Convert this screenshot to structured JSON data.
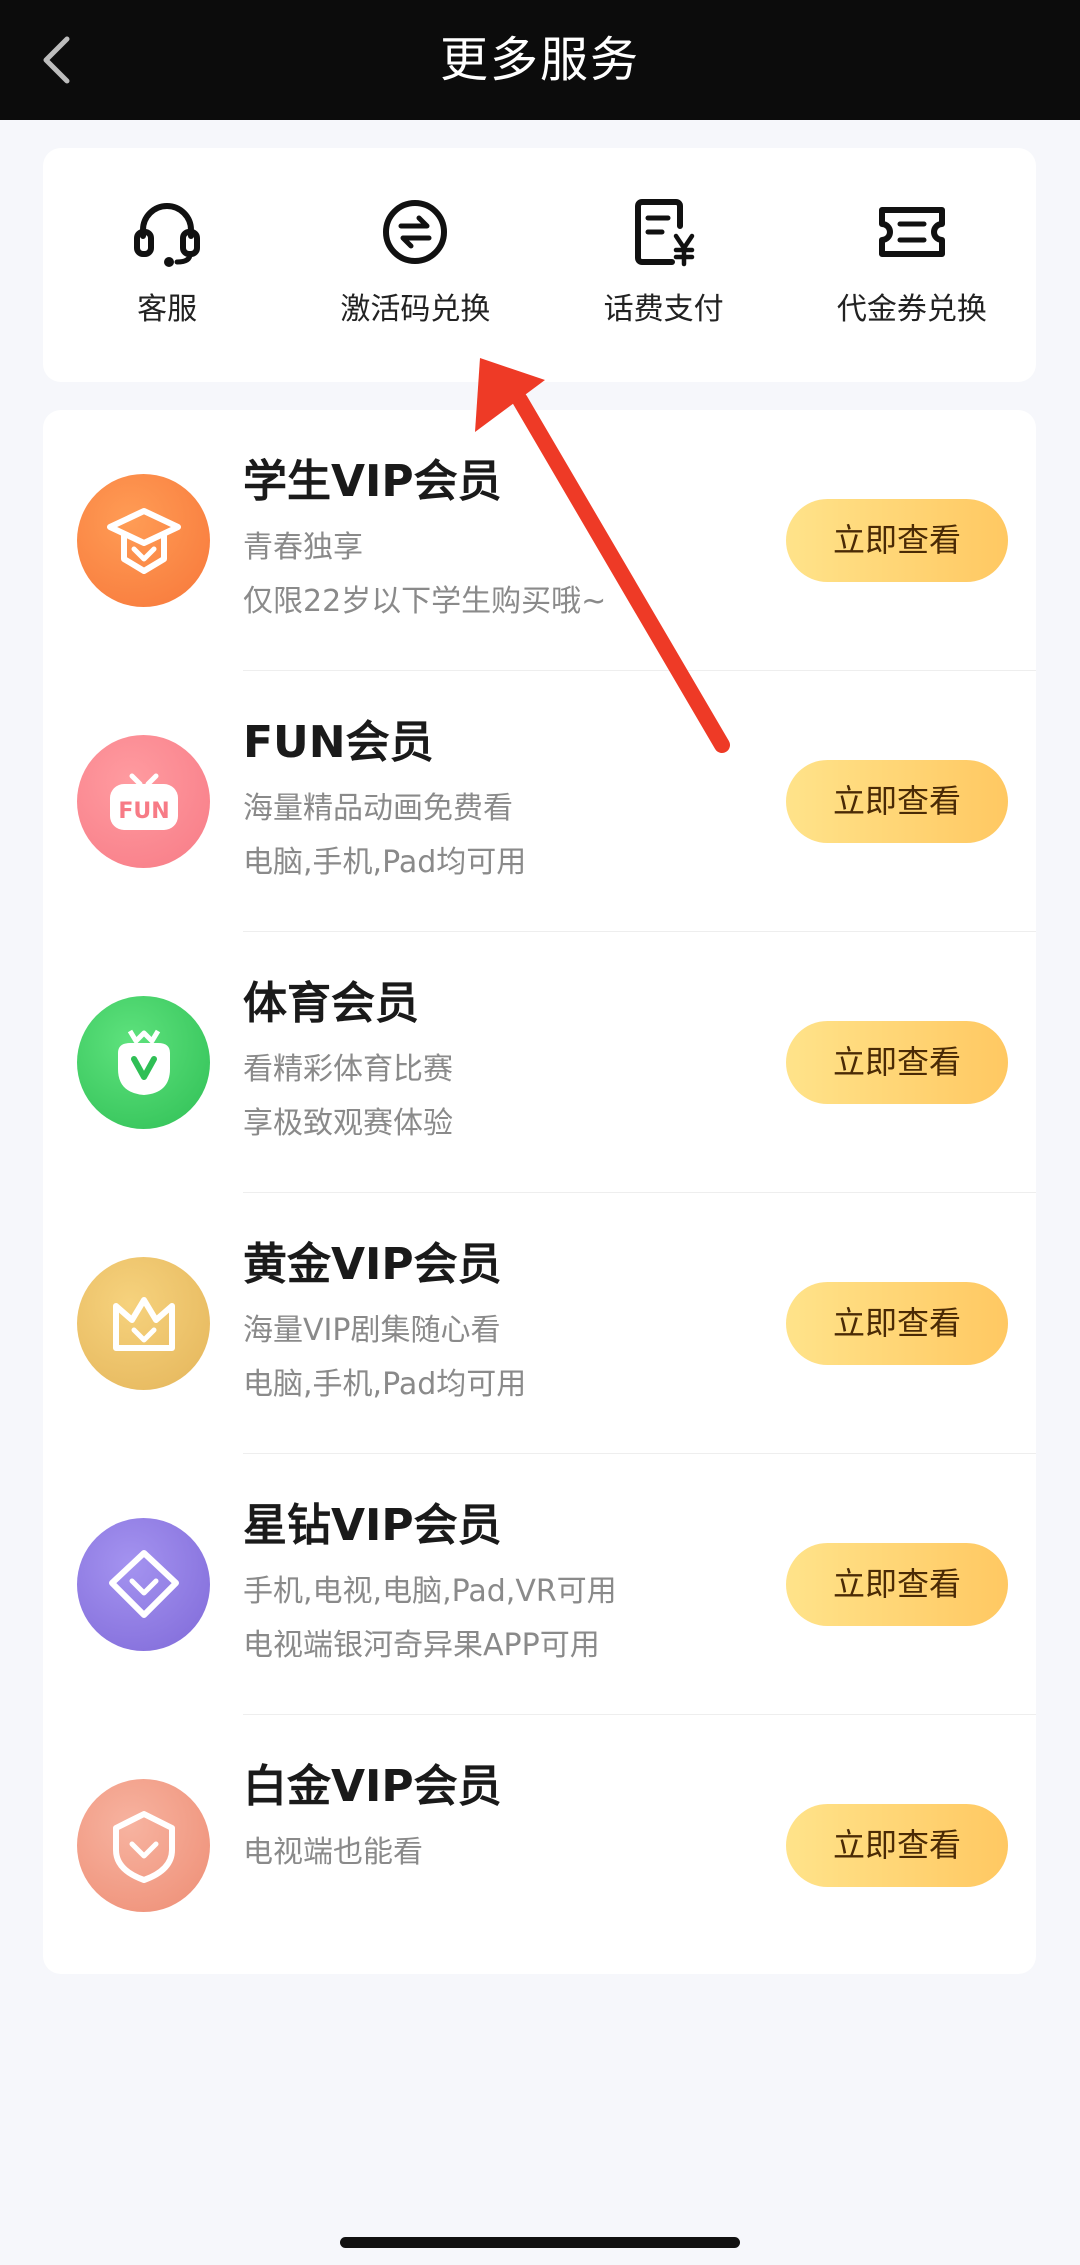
{
  "header": {
    "title": "更多服务",
    "back_icon": "chevron-left-icon"
  },
  "services": [
    {
      "label": "客服",
      "icon": "headset-icon"
    },
    {
      "label": "激活码兑换",
      "icon": "exchange-icon"
    },
    {
      "label": "话费支付",
      "icon": "bill-yuan-icon"
    },
    {
      "label": "代金券兑换",
      "icon": "ticket-icon"
    }
  ],
  "members": [
    {
      "name": "学生VIP会员",
      "desc1": "青春独享",
      "desc2": "仅限22岁以下学生购买哦~",
      "cta": "立即查看",
      "icon": "graduation-cap-icon",
      "color": "#f7873a"
    },
    {
      "name": "FUN会员",
      "desc1": "海量精品动画免费看",
      "desc2": "电脑,手机,Pad均可用",
      "cta": "立即查看",
      "icon": "fun-tv-icon",
      "color": "#f77e88"
    },
    {
      "name": "体育会员",
      "desc1": "看精彩体育比赛",
      "desc2": "享极致观赛体验",
      "cta": "立即查看",
      "icon": "sports-badge-icon",
      "color": "#35c960"
    },
    {
      "name": "黄金VIP会员",
      "desc1": "海量VIP剧集随心看",
      "desc2": "电脑,手机,Pad均可用",
      "cta": "立即查看",
      "icon": "crown-icon",
      "color": "#e9bb5f"
    },
    {
      "name": "星钻VIP会员",
      "desc1": "手机,电视,电脑,Pad,VR可用",
      "desc2": "电视端银河奇异果APP可用",
      "cta": "立即查看",
      "icon": "diamond-icon",
      "color": "#8d78e0"
    },
    {
      "name": "白金VIP会员",
      "desc1": "电视端也能看",
      "desc2": "",
      "cta": "立即查看",
      "icon": "shield-icon",
      "color": "#f09a82"
    }
  ],
  "accent_color": "#ffc862"
}
